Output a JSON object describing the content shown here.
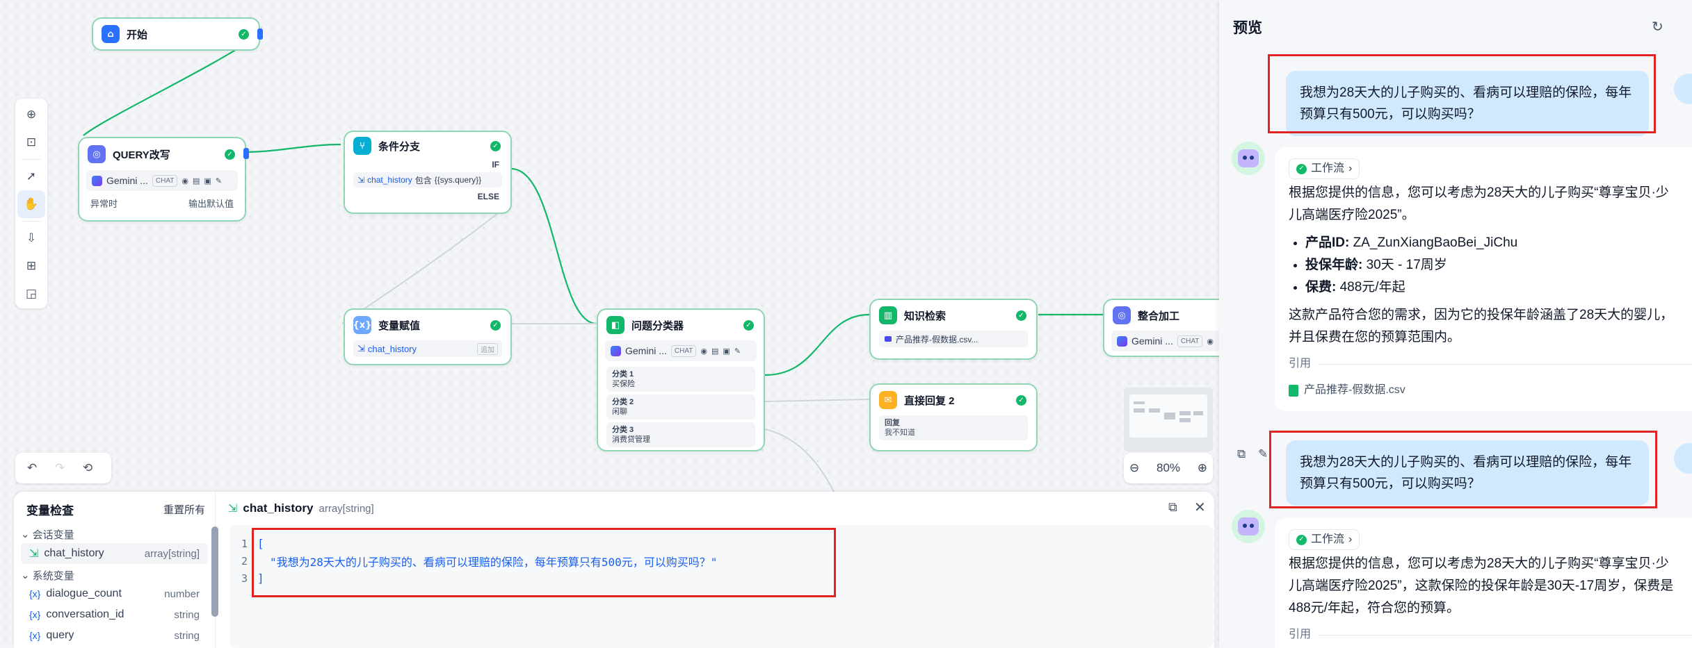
{
  "nodes": {
    "start": {
      "title": "开始"
    },
    "query_rewrite": {
      "title": "QUERY改写",
      "model": "Gemini ...",
      "badge": "CHAT",
      "left_label": "异常时",
      "right_label": "输出默认值"
    },
    "condition": {
      "title": "条件分支",
      "if_label": "IF",
      "var": "chat_history",
      "op": "包含",
      "value": "{{sys.query}}",
      "else_label": "ELSE"
    },
    "assign": {
      "title": "变量赋值",
      "var": "chat_history",
      "tag": "追加"
    },
    "classifier": {
      "title": "问题分类器",
      "model": "Gemini ...",
      "badge": "CHAT",
      "categories": [
        {
          "name": "分类 1",
          "value": "买保险"
        },
        {
          "name": "分类 2",
          "value": "闲聊"
        },
        {
          "name": "分类 3",
          "value": "消费贷管理"
        }
      ]
    },
    "knowledge": {
      "title": "知识检索",
      "file": "产品推荐-假数据.csv..."
    },
    "reply": {
      "title": "直接回复 2",
      "label": "回复",
      "text": "我不知道"
    },
    "integrate": {
      "title": "整合加工",
      "model": "Gemini ...",
      "badge": "CHAT"
    }
  },
  "zoom": {
    "value": "80%"
  },
  "variable_panel": {
    "title": "变量检查",
    "reset": "重置所有",
    "conv_group": "会话变量",
    "sys_group": "系统变量",
    "conv_vars": [
      {
        "name": "chat_history",
        "type": "array[string]"
      }
    ],
    "sys_vars": [
      {
        "name": "dialogue_count",
        "type": "number"
      },
      {
        "name": "conversation_id",
        "type": "string"
      },
      {
        "name": "query",
        "type": "string"
      }
    ],
    "selected": {
      "name": "chat_history",
      "type": "array[string]"
    },
    "code_lines": [
      "[",
      "\"我想为28天大的儿子购买的、看病可以理赔的保险，每年预算只有500元，可以购买吗？\"",
      "]"
    ]
  },
  "preview": {
    "title": "预览",
    "messages": [
      {
        "role": "user",
        "text": "我想为28天大的儿子购买的、看病可以理赔的保险，每年预算只有500元，可以购买吗？"
      },
      {
        "role": "assistant",
        "workflow": "工作流",
        "intro": "根据您提供的信息，您可以考虑为28天大的儿子购买“尊享宝贝·少儿高端医疗险2025”。",
        "bullets": [
          {
            "k": "产品ID:",
            "v": "ZA_ZunXiangBaoBei_JiChu"
          },
          {
            "k": "投保年龄:",
            "v": "30天 - 17周岁"
          },
          {
            "k": "保费:",
            "v": "488元/年起"
          }
        ],
        "conclusion": "这款产品符合您的需求，因为它的投保年龄涵盖了28天大的婴儿，并且保费在您的预算范围内。",
        "cite_label": "引用",
        "cite_file": "产品推荐-假数据.csv"
      },
      {
        "role": "user",
        "text": "我想为28天大的儿子购买的、看病可以理赔的保险，每年预算只有500元，可以购买吗？"
      },
      {
        "role": "assistant",
        "workflow": "工作流",
        "intro": "根据您提供的信息，您可以考虑为28天大的儿子购买“尊享宝贝·少儿高端医疗险2025”，这款保险的投保年龄是30天-17周岁，保费是488元/年起，符合您的预算。",
        "cite_label": "引用"
      }
    ]
  },
  "colors": {
    "accent": "#155eef",
    "edge": "#12b76a",
    "highlight": "#e02424"
  }
}
